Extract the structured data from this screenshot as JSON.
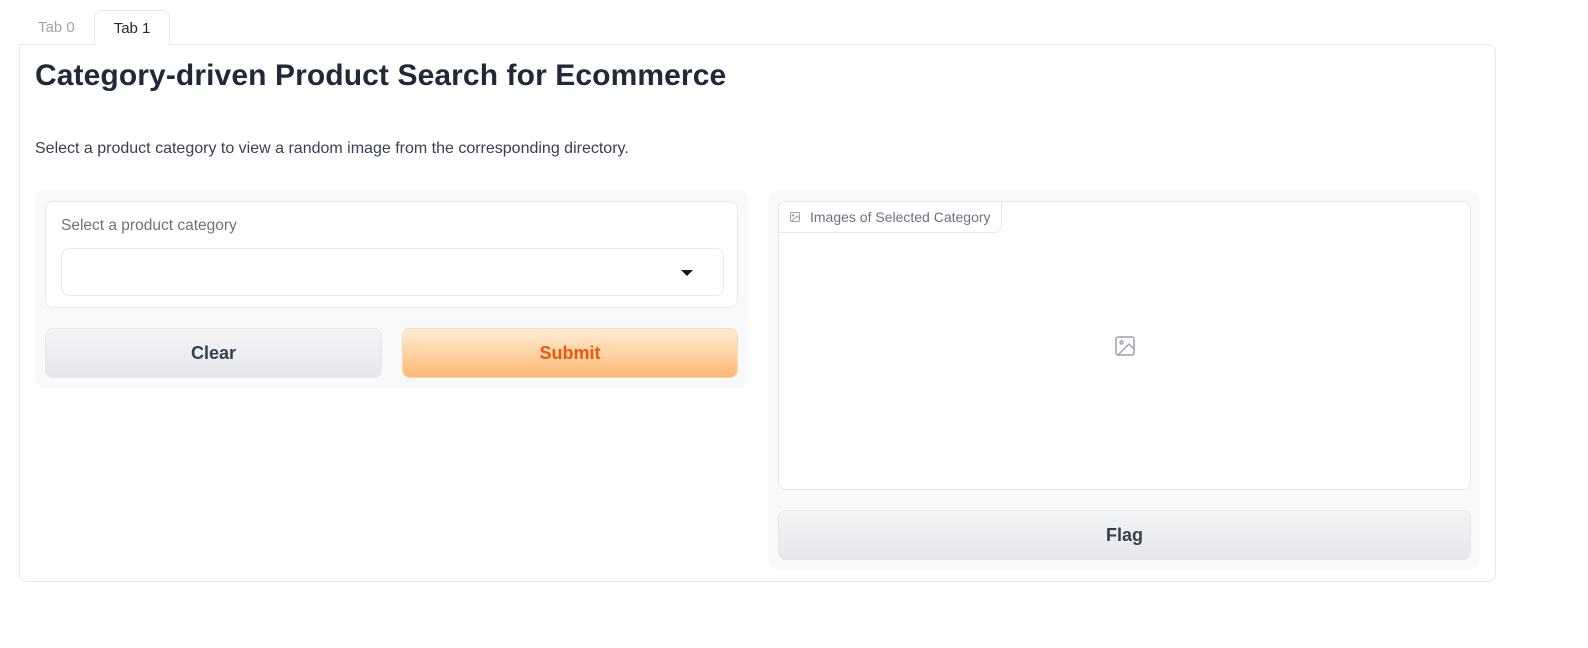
{
  "tabs": [
    {
      "label": "Tab 0",
      "active": false
    },
    {
      "label": "Tab 1",
      "active": true
    }
  ],
  "main": {
    "title": "Category-driven Product Search for Ecommerce",
    "description": "Select a product category to view a random image from the corresponding directory."
  },
  "input": {
    "dropdown_label": "Select a product category",
    "dropdown_value": "",
    "dropdown_icon": "caret-down-icon"
  },
  "buttons": {
    "clear_label": "Clear",
    "submit_label": "Submit",
    "flag_label": "Flag"
  },
  "output": {
    "image_label": "Images of Selected Category",
    "image_label_icon": "image-icon",
    "placeholder_icon": "image-icon"
  },
  "colors": {
    "submit_text": "#ea580c",
    "submit_gradient_start": "#ffedd5",
    "submit_gradient_end": "#fdba74",
    "secondary_button_bg": "#e5e7eb",
    "border": "#e5e7eb",
    "title_text": "#1f2937"
  }
}
